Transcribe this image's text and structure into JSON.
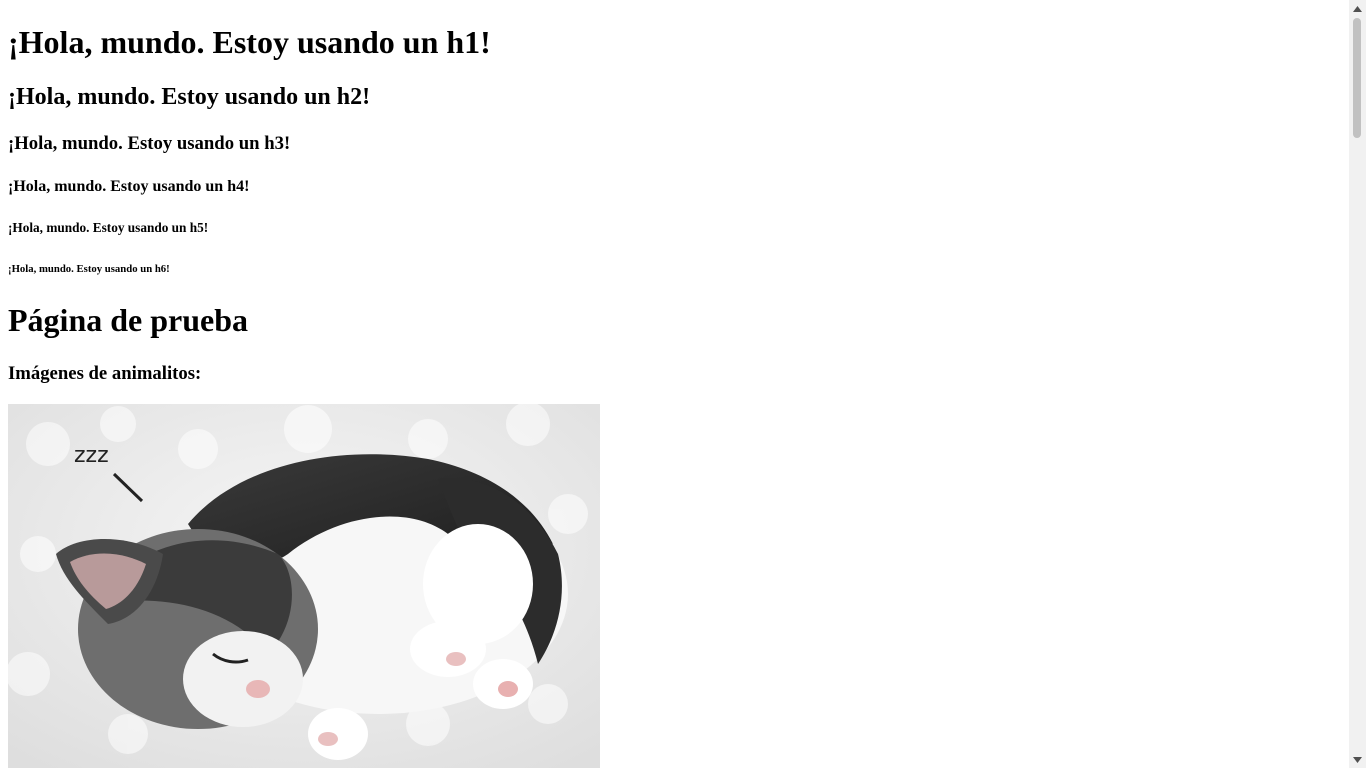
{
  "headings": {
    "h1": "¡Hola, mundo. Estoy usando un h1!",
    "h2": "¡Hola, mundo. Estoy usando un h2!",
    "h3": "¡Hola, mundo. Estoy usando un h3!",
    "h4": "¡Hola, mundo. Estoy usando un h4!",
    "h5": "¡Hola, mundo. Estoy usando un h5!",
    "h6": "¡Hola, mundo. Estoy usando un h6!"
  },
  "page_title": "Página de prueba",
  "section_title": "Imágenes de animalitos:",
  "image": {
    "caption_text": "zzz",
    "subject": "sleeping kitten"
  },
  "colors": {
    "background": "#ffffff",
    "text": "#000000",
    "scrollbar_track": "#f1f1f1",
    "scrollbar_thumb": "#c1c1c1"
  }
}
